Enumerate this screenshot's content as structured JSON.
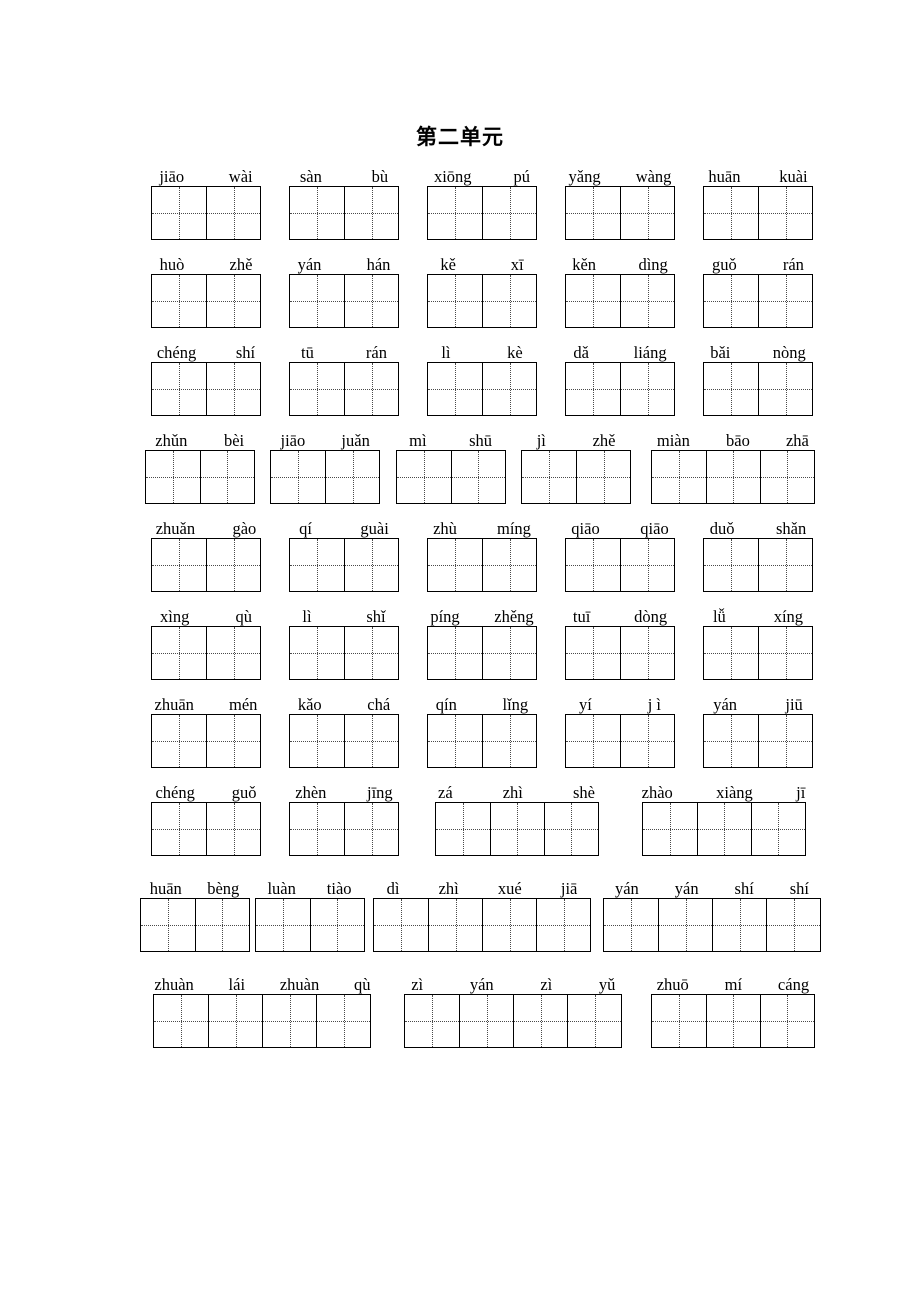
{
  "document": {
    "title": "第二单元",
    "type": "pinyin-writing-worksheet",
    "grid_style": "tian-zi-ge"
  },
  "rows": [
    {
      "id": "row-1",
      "items": [
        {
          "pinyin": [
            "jiāo",
            "wài"
          ],
          "cells": 2
        },
        {
          "pinyin": [
            "sàn",
            "bù"
          ],
          "cells": 2
        },
        {
          "pinyin": [
            "xiōng",
            "pú"
          ],
          "cells": 2
        },
        {
          "pinyin": [
            "yǎng",
            "wàng"
          ],
          "cells": 2
        },
        {
          "pinyin": [
            "huān",
            "kuài"
          ],
          "cells": 2
        }
      ]
    },
    {
      "id": "row-2",
      "items": [
        {
          "pinyin": [
            "huò",
            "zhě"
          ],
          "cells": 2
        },
        {
          "pinyin": [
            "yán",
            "hán"
          ],
          "cells": 2
        },
        {
          "pinyin": [
            "kě",
            "xī"
          ],
          "cells": 2
        },
        {
          "pinyin": [
            "kěn",
            "dìng"
          ],
          "cells": 2
        },
        {
          "pinyin": [
            "guǒ",
            "rán"
          ],
          "cells": 2
        }
      ]
    },
    {
      "id": "row-3",
      "items": [
        {
          "pinyin": [
            "chéng",
            "shí"
          ],
          "cells": 2
        },
        {
          "pinyin": [
            "tū",
            "rán"
          ],
          "cells": 2
        },
        {
          "pinyin": [
            "lì",
            "kè"
          ],
          "cells": 2
        },
        {
          "pinyin": [
            "dǎ",
            "liáng"
          ],
          "cells": 2
        },
        {
          "pinyin": [
            "bǎi",
            "nòng"
          ],
          "cells": 2
        }
      ]
    },
    {
      "id": "row-4",
      "items": [
        {
          "pinyin": [
            "zhǔn",
            "bèi"
          ],
          "cells": 2
        },
        {
          "pinyin": [
            "jiāo",
            "juǎn"
          ],
          "cells": 2
        },
        {
          "pinyin": [
            "mì",
            "shū"
          ],
          "cells": 2
        },
        {
          "pinyin": [
            "jì",
            "zhě"
          ],
          "cells": 2
        },
        {
          "pinyin": [
            "miàn",
            "bāo",
            "zhā"
          ],
          "cells": 3
        }
      ]
    },
    {
      "id": "row-5",
      "items": [
        {
          "pinyin": [
            "zhuǎn",
            "gào"
          ],
          "cells": 2
        },
        {
          "pinyin": [
            "qí",
            "guài"
          ],
          "cells": 2
        },
        {
          "pinyin": [
            "zhù",
            "míng"
          ],
          "cells": 2
        },
        {
          "pinyin": [
            "qiāo",
            "qiāo"
          ],
          "cells": 2
        },
        {
          "pinyin": [
            "duǒ",
            "shǎn"
          ],
          "cells": 2
        }
      ]
    },
    {
      "id": "row-6",
      "items": [
        {
          "pinyin": [
            "xìng",
            "qù"
          ],
          "cells": 2
        },
        {
          "pinyin": [
            "lì",
            "shǐ"
          ],
          "cells": 2
        },
        {
          "pinyin": [
            "píng",
            "zhěng"
          ],
          "cells": 2
        },
        {
          "pinyin": [
            "tuī",
            "dòng"
          ],
          "cells": 2
        },
        {
          "pinyin": [
            "lǚ",
            "xíng"
          ],
          "cells": 2
        }
      ]
    },
    {
      "id": "row-7",
      "items": [
        {
          "pinyin": [
            "zhuān",
            "mén"
          ],
          "cells": 2
        },
        {
          "pinyin": [
            "kǎo",
            "chá"
          ],
          "cells": 2
        },
        {
          "pinyin": [
            "qín",
            "lǐng"
          ],
          "cells": 2
        },
        {
          "pinyin": [
            "yí",
            "j ì"
          ],
          "cells": 2
        },
        {
          "pinyin": [
            "yán",
            "jiū"
          ],
          "cells": 2
        }
      ]
    },
    {
      "id": "row-8",
      "items": [
        {
          "pinyin": [
            "chéng",
            "guǒ"
          ],
          "cells": 2
        },
        {
          "pinyin": [
            "zhèn",
            "jīng"
          ],
          "cells": 2
        },
        {
          "pinyin": [
            "zá",
            "zhì",
            "shè"
          ],
          "cells": 3
        },
        {
          "pinyin": [
            "zhào",
            "xiàng",
            "jī"
          ],
          "cells": 3
        }
      ]
    },
    {
      "id": "row-9",
      "items": [
        {
          "pinyin": [
            "huān",
            "bèng"
          ],
          "cells": 2
        },
        {
          "pinyin": [
            "luàn",
            "tiào"
          ],
          "cells": 2
        },
        {
          "pinyin": [
            "dì",
            "zhì",
            "xué",
            "jiā"
          ],
          "cells": 4
        },
        {
          "pinyin": [
            "yán",
            "yán",
            "shí",
            "shí"
          ],
          "cells": 4
        }
      ]
    },
    {
      "id": "row-10",
      "items": [
        {
          "pinyin": [
            "zhuàn",
            "lái",
            "zhuàn",
            "qù"
          ],
          "cells": 4
        },
        {
          "pinyin": [
            "zì",
            "yán",
            "zì",
            "yǔ"
          ],
          "cells": 4
        },
        {
          "pinyin": [
            "zhuō",
            "mí",
            "cáng"
          ],
          "cells": 3
        }
      ]
    }
  ]
}
